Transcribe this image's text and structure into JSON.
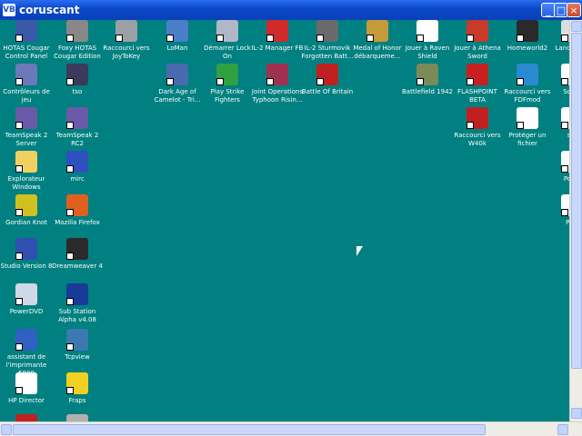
{
  "window": {
    "title": "coruscant",
    "app_icon": "VB",
    "minimize": "_",
    "maximize": "□",
    "close": "×"
  },
  "colors": {
    "desktop": "#008080",
    "titlebar": "#0a47c9"
  },
  "icons": [
    {
      "label": "HOTAS Cougar Control Panel",
      "icon": "jet-icon",
      "color": "#3a5aa8"
    },
    {
      "label": "Foxy HOTAS Cougar Edition",
      "icon": "fox-icon",
      "color": "#888888"
    },
    {
      "label": "Raccourci vers JoyToKey",
      "icon": "joystick-icon",
      "color": "#9aa0a6"
    },
    {
      "label": "LoMan",
      "icon": "loman-icon",
      "color": "#4a7ec9"
    },
    {
      "label": "Démarrer Lock On",
      "icon": "jet-icon",
      "color": "#b0b8c8"
    },
    {
      "label": "IL-2 Manager FB",
      "icon": "m-icon",
      "color": "#d02a2a"
    },
    {
      "label": "IL-2 Sturmovik Forgotten Batt...",
      "icon": "plane-icon",
      "color": "#6a6a6a"
    },
    {
      "label": "Medal of Honor débarqueme...",
      "icon": "medal-icon",
      "color": "#c49a3a"
    },
    {
      "label": "Jouer à Raven Shield",
      "icon": "rs-icon",
      "color": "#ffffff"
    },
    {
      "label": "Jouer à Athena Sword",
      "icon": "as-icon",
      "color": "#c83a2a"
    },
    {
      "label": "Homeworld2",
      "icon": "homeworld-icon",
      "color": "#2a2a2a"
    },
    {
      "label": "Lance Dan",
      "icon": "lance-icon",
      "color": "#dddddd"
    },
    {
      "label": "Contrôleurs de jeu",
      "icon": "gamepad-icon",
      "color": "#6a7ab8"
    },
    {
      "label": "tso",
      "icon": "tso-icon",
      "color": "#3a3a5a"
    },
    {
      "label": "Dark Age of Camelot - Tri...",
      "icon": "dragon-icon",
      "color": "#4a6ab0"
    },
    {
      "label": "Play Strike Fighters",
      "icon": "strike-icon",
      "color": "#30a040"
    },
    {
      "label": "Joint Operations Typhoon Risin...",
      "icon": "jo-icon",
      "color": "#a03050"
    },
    {
      "label": "Battle Of Britain",
      "icon": "roundel-icon",
      "color": "#c02020"
    },
    {
      "label": "Battlefield 1942",
      "icon": "battlefield-icon",
      "color": "#7a8a5a"
    },
    {
      "label": "FLASHPOINT BETA",
      "icon": "flashpoint-icon",
      "color": "#c82020"
    },
    {
      "label": "Raccourci vers FDFmod",
      "icon": "fdf-icon",
      "color": "#2a8ad0"
    },
    {
      "label": "Soldn",
      "icon": "soldier-icon",
      "color": "#ffffff"
    },
    {
      "label": "TeamSpeak 2 Server",
      "icon": "teamspeak-icon",
      "color": "#6a5aa8"
    },
    {
      "label": "TeamSpeak 2 RC2",
      "icon": "teamspeak-icon",
      "color": "#6a5aa8"
    },
    {
      "label": "Raccourci vers W40k",
      "icon": "skull-icon",
      "color": "#c02020"
    },
    {
      "label": "Protéger un fichier",
      "icon": "document-icon",
      "color": "#ffffff"
    },
    {
      "label": "sm",
      "icon": "sm-icon",
      "color": "#ffffff"
    },
    {
      "label": "Explorateur Windows",
      "icon": "folder-icon",
      "color": "#f0d060"
    },
    {
      "label": "mirc",
      "icon": "mirc-icon",
      "color": "#3050c0"
    },
    {
      "label": "Porta",
      "icon": "porta-icon",
      "color": "#ffffff"
    },
    {
      "label": "Gordian Knot",
      "icon": "knot-icon",
      "color": "#d0c020"
    },
    {
      "label": "Mozilla Firefox",
      "icon": "firefox-icon",
      "color": "#e06020"
    },
    {
      "label": "Prot",
      "icon": "prot-icon",
      "color": "#ffffff"
    },
    {
      "label": "Studio Version 8",
      "icon": "studio-icon",
      "color": "#3050b0"
    },
    {
      "label": "Dreamweaver 4",
      "icon": "dreamweaver-icon",
      "color": "#2a2a2a"
    },
    {
      "label": "PowerDVD",
      "icon": "dvd-icon",
      "color": "#d0d8e8"
    },
    {
      "label": "Sub Station Alpha v4.08",
      "icon": "flag-icon",
      "color": "#1a3a9a"
    },
    {
      "label": "assistant de l'imprimante 5800",
      "icon": "hp-icon",
      "color": "#3060c0"
    },
    {
      "label": "Tcpview",
      "icon": "network-icon",
      "color": "#3a7ab0"
    },
    {
      "label": "HP Director",
      "icon": "hp-director-icon",
      "color": "#ffffff"
    },
    {
      "label": "Fraps",
      "icon": "fraps-icon",
      "color": "#f0d020"
    },
    {
      "label": "",
      "icon": "partial-icon",
      "color": "#c02020"
    },
    {
      "label": "",
      "icon": "partial-icon",
      "color": "#b0b0b0"
    }
  ]
}
